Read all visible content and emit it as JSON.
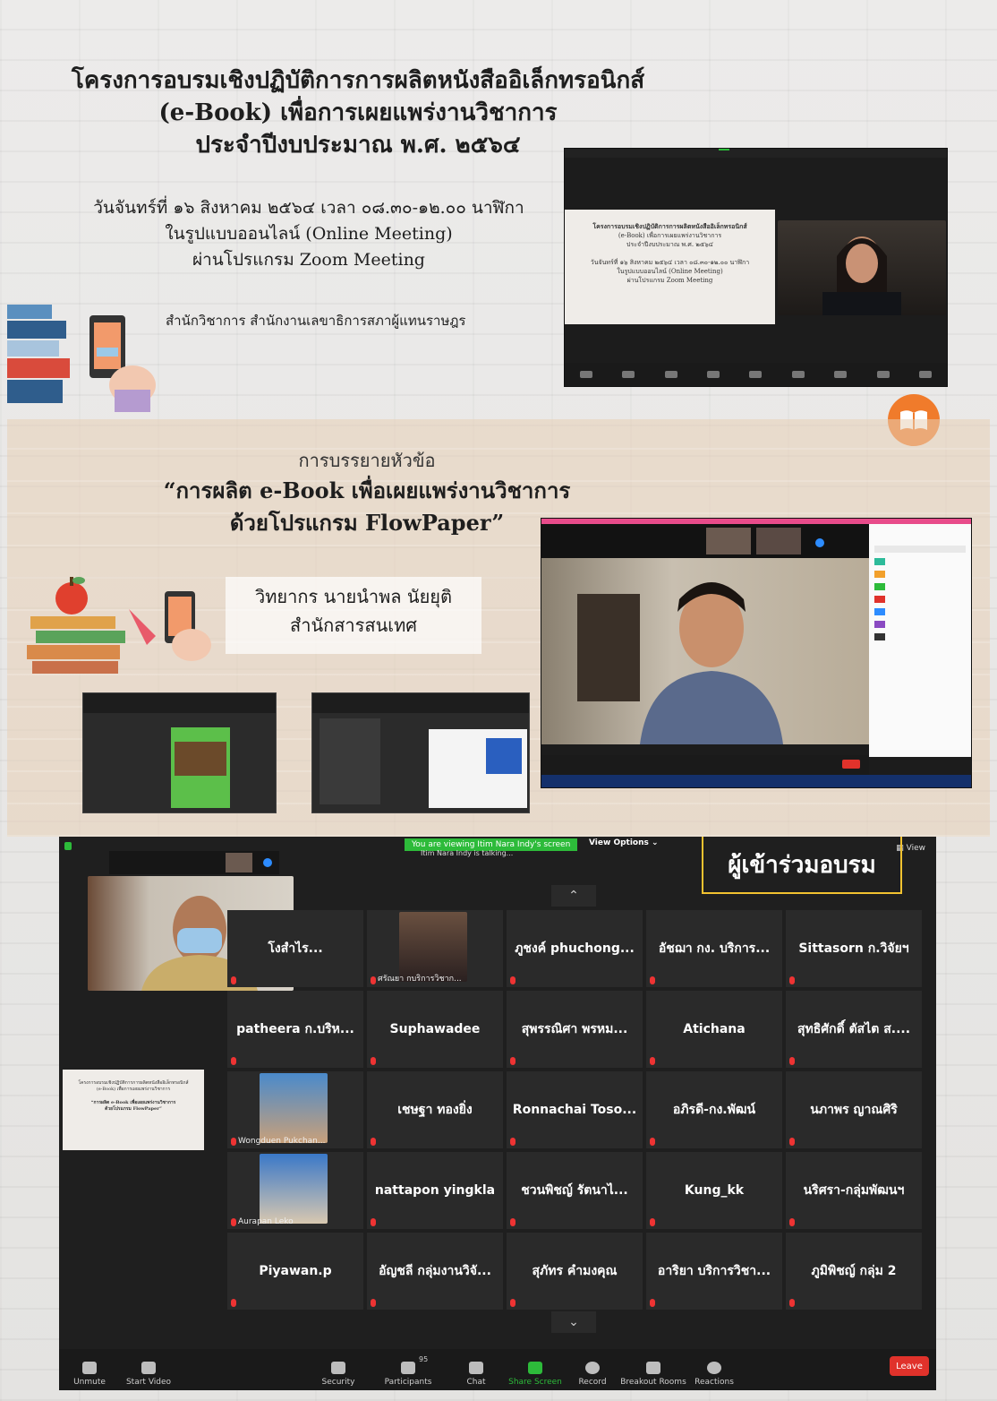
{
  "section1": {
    "title_line1": "โครงการอบรมเชิงปฏิบัติการการผลิตหนังสืออิเล็กทรอนิกส์",
    "title_line2": "(e-Book) เพื่อการเผยแพร่งานวิชาการ",
    "title_line3": "ประจำปีงบประมาณ พ.ศ. ๒๕๖๔",
    "date_line1": "วันจันทร์ที่ ๑๖ สิงหาคม ๒๕๖๔ เวลา ๐๘.๓๐-๑๒.๐๐ นาฬิกา",
    "date_line2": "ในรูปแบบออนไลน์ (Online Meeting)",
    "date_line3": "ผ่านโปรแกรม Zoom Meeting",
    "organizer": "สำนักวิชาการ สำนักงานเลขาธิการสภาผู้แทนราษฎร"
  },
  "section2": {
    "topic_label": "การบรรยายหัวข้อ",
    "topic_line1": "“การผลิต e-Book เพื่อเผยแพร่งานวิชาการ",
    "topic_line2": "ด้วยโปรแกรม FlowPaper”",
    "speaker_line1": "วิทยากร นายนำพล นัยยุติ",
    "speaker_line2": "สำนักสารสนเทศ"
  },
  "zoom": {
    "viewing_banner": "You are viewing Itim Nara Indy's screen",
    "talking": "Itim Nara Indy is talking...",
    "view_options": "View Options",
    "view_label": "View",
    "caption": "ผู้เข้าร่วมอบรม",
    "tiles": [
      "โงสำไร...",
      "",
      "ภูชงค์ phuchong...",
      "อัชฌา กง. บริการ...",
      "Sittasorn ก.วิจัยฯ",
      "patheera ก.บริห...",
      "Suphawadee",
      "สุพรรณิศา พรหม...",
      "Atichana",
      "สุทธิศักดิ์ ตัสไต ส....",
      "",
      "เชษฐา ทองยิ่ง",
      "Ronnachai Toso...",
      "อภิรดี-กง.พัฒน์",
      "นภาพร ญาณศิริ",
      "",
      "nattapon yingkla",
      "ชวนพิชญ์ รัตนาไ...",
      "Kung_kk",
      "นริศรา-กลุ่มพัฒนฯ",
      "Piyawan.p",
      "อัญชลี กลุ่มงานวิจั...",
      "สุภัทร คำมงคุณ",
      "อาริยา บริการวิชา...",
      "ภูมิพิชญ์ กลุ่ม 2"
    ],
    "photo_captions": {
      "r1c2": "ศรัณยา กบริการวิชาก...",
      "r3c1": "Wongduen Pukchan...",
      "r4c1": "Aurapan Leko"
    },
    "participants_count": "95",
    "toolbar": {
      "unmute": "Unmute",
      "start_video": "Start Video",
      "security": "Security",
      "participants": "Participants",
      "chat": "Chat",
      "share_screen": "Share Screen",
      "record": "Record",
      "breakout": "Breakout Rooms",
      "reactions": "Reactions",
      "leave": "Leave"
    }
  },
  "colors": {
    "accent_orange": "#f07b2b",
    "zoom_green": "#2dbb3a",
    "leave_red": "#e0322b",
    "caption_yellow": "#f2c230"
  }
}
